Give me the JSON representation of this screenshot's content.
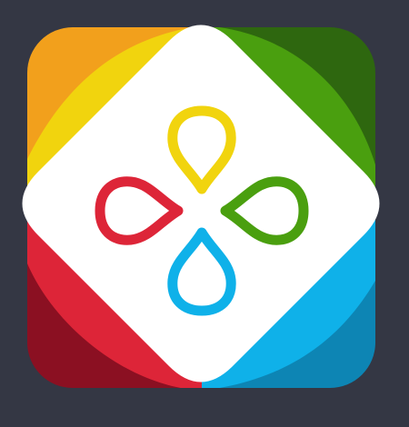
{
  "colors": {
    "background": "#343744",
    "orange": "#F2A01C",
    "yellow": "#F1D40E",
    "green_dark": "#2E670F",
    "green": "#4A9F0F",
    "red_dark": "#8B1022",
    "red": "#DD2538",
    "blue_dark": "#0D85B4",
    "blue": "#0FB1E9",
    "white": "#FFFFFF"
  },
  "icons": {
    "app_icon": "app-icon",
    "center_mark": "four-petal-drops-icon",
    "petals": [
      "yellow-drop-icon",
      "green-drop-icon",
      "blue-drop-icon",
      "red-drop-icon"
    ]
  }
}
